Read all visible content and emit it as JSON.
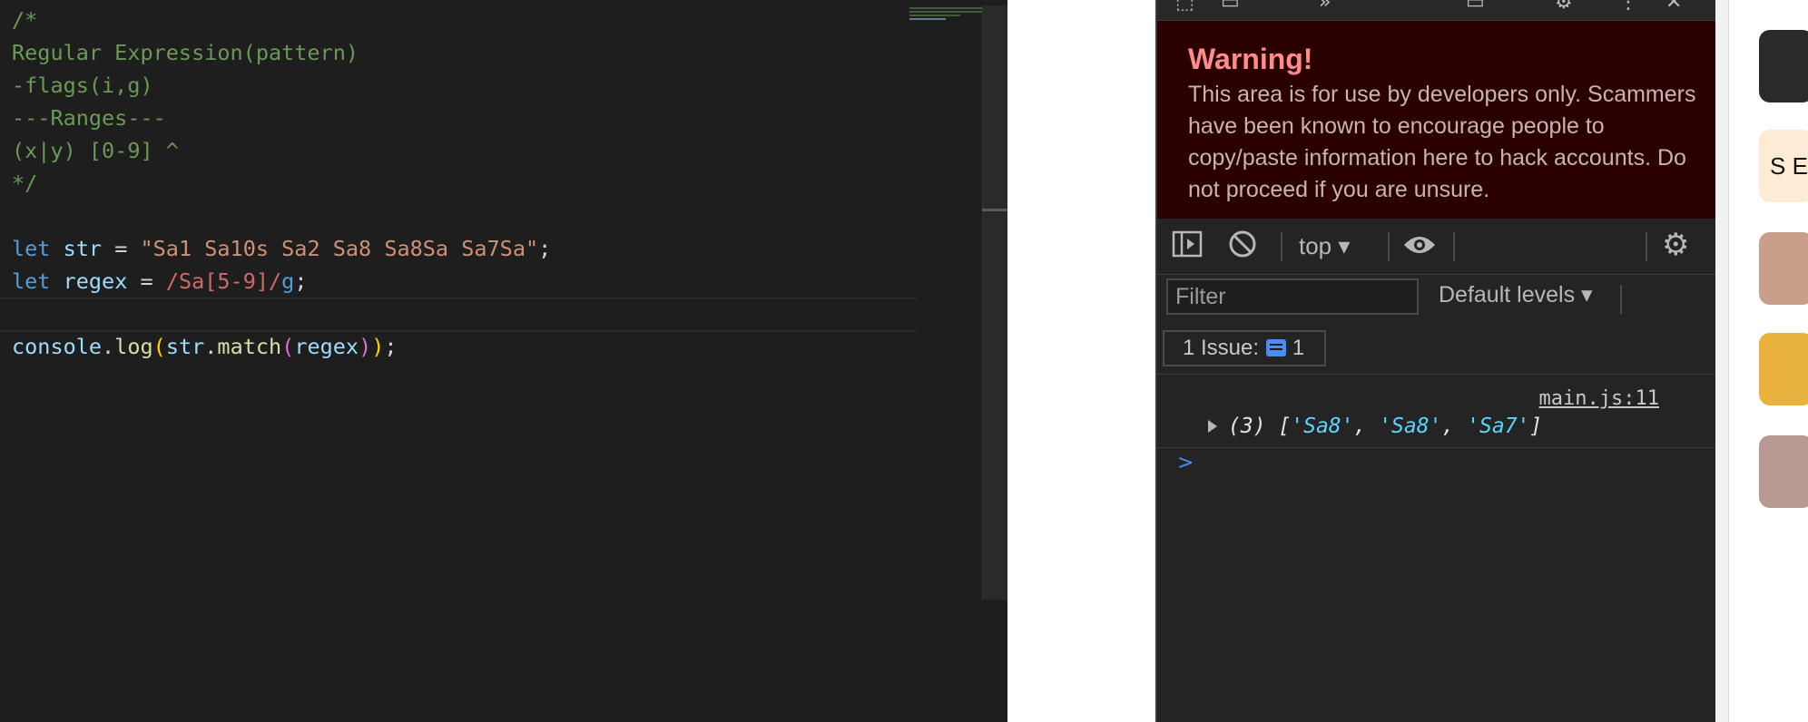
{
  "editor": {
    "lines": [
      {
        "tokens": [
          {
            "t": "/*",
            "c": "comment"
          }
        ]
      },
      {
        "tokens": [
          {
            "t": "Regular Expression(pattern)",
            "c": "comment"
          }
        ]
      },
      {
        "tokens": [
          {
            "t": "-flags(i,g)",
            "c": "comment"
          }
        ]
      },
      {
        "tokens": [
          {
            "t": "---Ranges---",
            "c": "comment"
          }
        ]
      },
      {
        "tokens": [
          {
            "t": "(x|y) [0-9] ^",
            "c": "comment"
          }
        ]
      },
      {
        "tokens": [
          {
            "t": "*/",
            "c": "comment"
          }
        ]
      },
      {
        "tokens": []
      },
      {
        "tokens": [
          {
            "t": "let",
            "c": "kw"
          },
          {
            "t": " "
          },
          {
            "t": "str",
            "c": "var"
          },
          {
            "t": " = "
          },
          {
            "t": "\"Sa1 Sa10s Sa2 Sa8 Sa8Sa Sa7Sa\"",
            "c": "str"
          },
          {
            "t": ";"
          }
        ]
      },
      {
        "tokens": [
          {
            "t": "let",
            "c": "kw"
          },
          {
            "t": " "
          },
          {
            "t": "regex",
            "c": "var"
          },
          {
            "t": " = "
          },
          {
            "t": "/Sa[5-9]/",
            "c": "regex"
          },
          {
            "t": "g",
            "c": "kw"
          },
          {
            "t": ";"
          }
        ]
      },
      {
        "tokens": [],
        "current": true
      },
      {
        "tokens": [
          {
            "t": "console",
            "c": "var"
          },
          {
            "t": "."
          },
          {
            "t": "log",
            "c": "fn"
          },
          {
            "t": "(",
            "c": "paren2"
          },
          {
            "t": "str",
            "c": "var"
          },
          {
            "t": "."
          },
          {
            "t": "match",
            "c": "fn"
          },
          {
            "t": "(",
            "c": "paren"
          },
          {
            "t": "regex",
            "c": "var"
          },
          {
            "t": ")",
            "c": "paren"
          },
          {
            "t": ")",
            "c": "paren2"
          },
          {
            "t": ";"
          }
        ]
      }
    ]
  },
  "devtools": {
    "warning_title": "Warning!",
    "warning_text": "This area is for use by developers only. Scammers have been known to encourage people to copy/paste information here to hack accounts. Do not proceed if you are unsure.",
    "context_label": "top",
    "filter_placeholder": "Filter",
    "levels_label": "Default levels",
    "issues_label": "1 Issue:",
    "issues_count": "1",
    "log": {
      "source": "main.js:11",
      "count": "(3)",
      "items": [
        "'Sa8'",
        "'Sa8'",
        "'Sa7'"
      ]
    },
    "prompt_symbol": ">"
  },
  "sidebar_chip": "S E",
  "colors": {
    "editor_bg": "#1e1e1e",
    "warning_bg": "#2b0000",
    "warning_title": "#ff8b8b",
    "accent_blue": "#4b8cf5",
    "string_cyan": "#5cd5fb"
  }
}
